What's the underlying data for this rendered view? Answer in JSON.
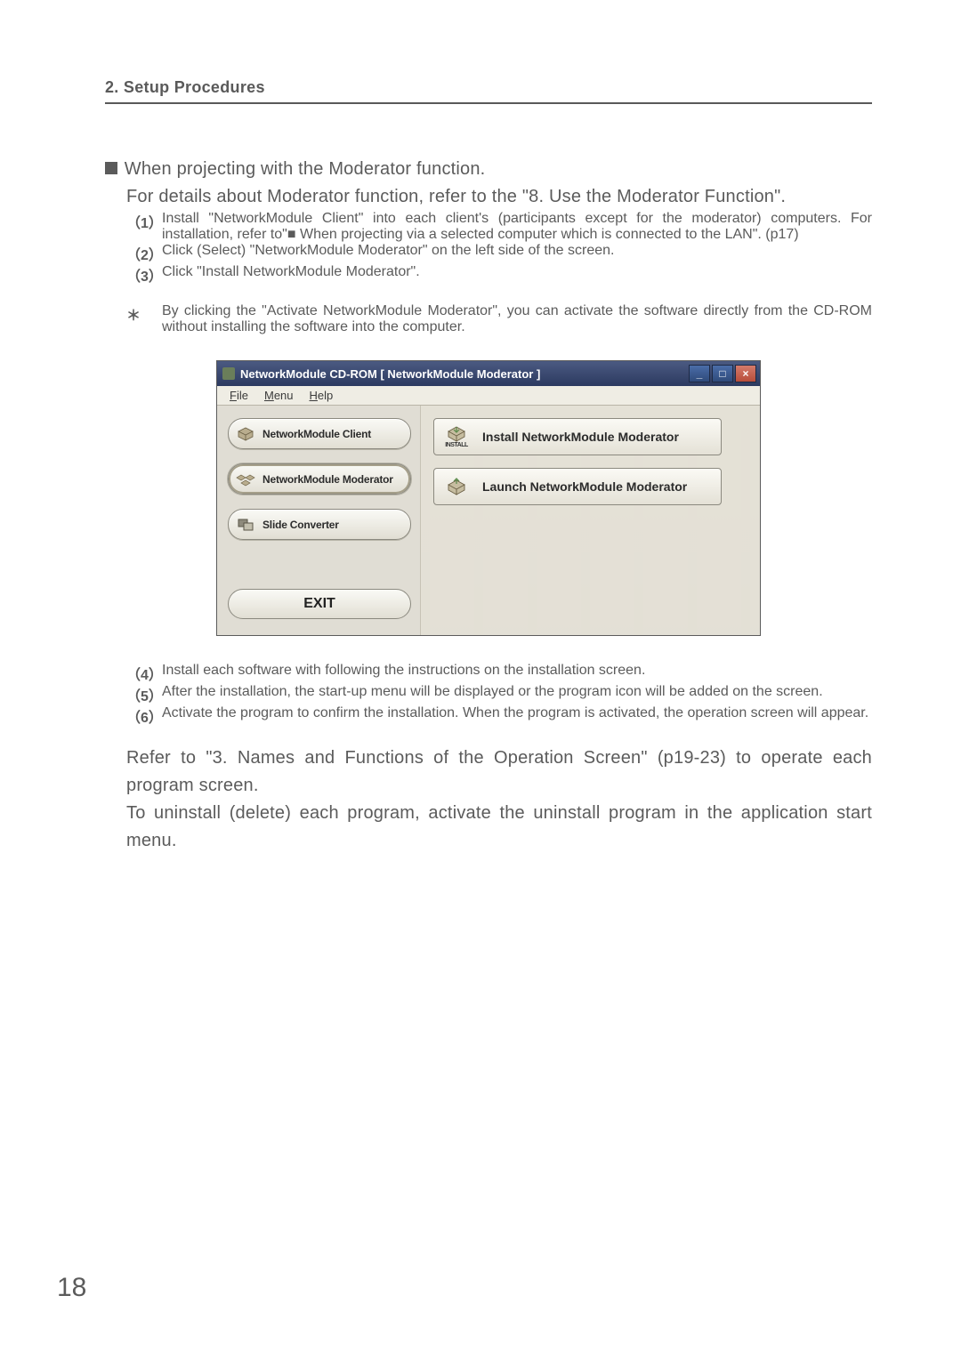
{
  "header": {
    "title": "2. Setup Procedures"
  },
  "section": {
    "heading_prefix": "■",
    "heading": "When projecting with the Moderator function.",
    "intro": "For details about Moderator function, refer to the \"8. Use the Moderator Function\".",
    "steps_a": [
      {
        "num": "（1）",
        "text": "Install \"NetworkModule Client\" into each client's (participants except for the moderator) computers.  For installation, refer to\"■ When projecting via a selected computer which is connected to the LAN\".  (p17)"
      },
      {
        "num": "（2）",
        "text": "Click (Select) \"NetworkModule Moderator\" on the left side of the screen."
      },
      {
        "num": "（3）",
        "text": "Click \"Install NetworkModule Moderator\"."
      }
    ],
    "note_prefix": "＊",
    "note": "By clicking the \"Activate NetworkModule Moderator\", you can activate the software directly from the CD-ROM without installing the software into the computer.",
    "steps_b": [
      {
        "num": "（4）",
        "text": "Install each software with following the instructions on the installation screen."
      },
      {
        "num": "（5）",
        "text": "After the installation, the start-up menu will be displayed or the program icon will be added on the screen."
      },
      {
        "num": "（6）",
        "text": "Activate the program to confirm the installation.  When the program is activated, the operation screen will appear."
      }
    ],
    "footer1": "Refer to \"3. Names and Functions of the Operation Screen\" (p19-23) to operate each program screen.",
    "footer2": "To uninstall (delete) each program, activate the uninstall program in the application start menu."
  },
  "window": {
    "title": "NetworkModule CD-ROM    [ NetworkModule Moderator ]",
    "menubar": {
      "file": "File",
      "menu": "Menu",
      "help": "Help"
    },
    "sidebar": {
      "items": [
        {
          "label": "NetworkModule Client",
          "icon": "box-icon"
        },
        {
          "label": "NetworkModule Moderator",
          "icon": "boxes-icon"
        },
        {
          "label": "Slide Converter",
          "icon": "slide-icon"
        }
      ],
      "exit": "EXIT"
    },
    "main": {
      "buttons": [
        {
          "label": "Install NetworkModule Moderator",
          "icon": "install-icon",
          "icon_sublabel": "INSTALL"
        },
        {
          "label": "Launch NetworkModule Moderator",
          "icon": "launch-icon",
          "icon_sublabel": ""
        }
      ]
    },
    "controls": {
      "min": "_",
      "max": "□",
      "close": "×"
    }
  },
  "page_number": "18"
}
